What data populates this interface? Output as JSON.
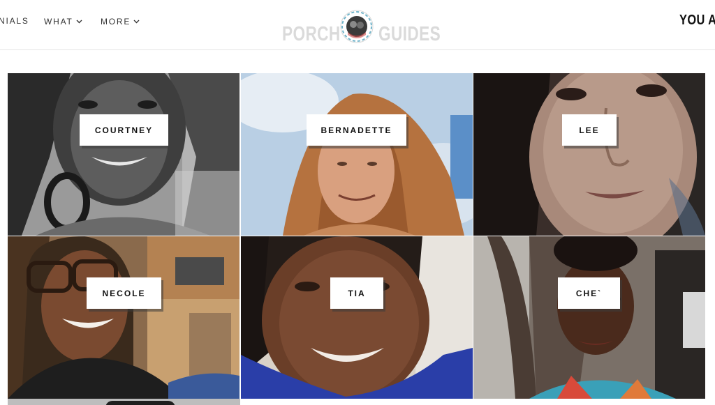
{
  "nav": {
    "items": [
      {
        "label": "NIALS",
        "has_dropdown": false
      },
      {
        "label": "WHAT",
        "has_dropdown": true
      },
      {
        "label": "MORE",
        "has_dropdown": true
      }
    ]
  },
  "logo": {
    "left_word": "PORCH",
    "right_word": "GUIDES"
  },
  "header_right": "YOU AR",
  "guides": [
    {
      "name": "COURTNEY"
    },
    {
      "name": "BERNADETTE"
    },
    {
      "name": "LEE"
    },
    {
      "name": "NECOLE"
    },
    {
      "name": "TIA"
    },
    {
      "name": "CHE`"
    }
  ],
  "colors": {
    "accent_text": "#111111",
    "logo_gray": "#dadada",
    "divider": "#e4e4e4"
  }
}
